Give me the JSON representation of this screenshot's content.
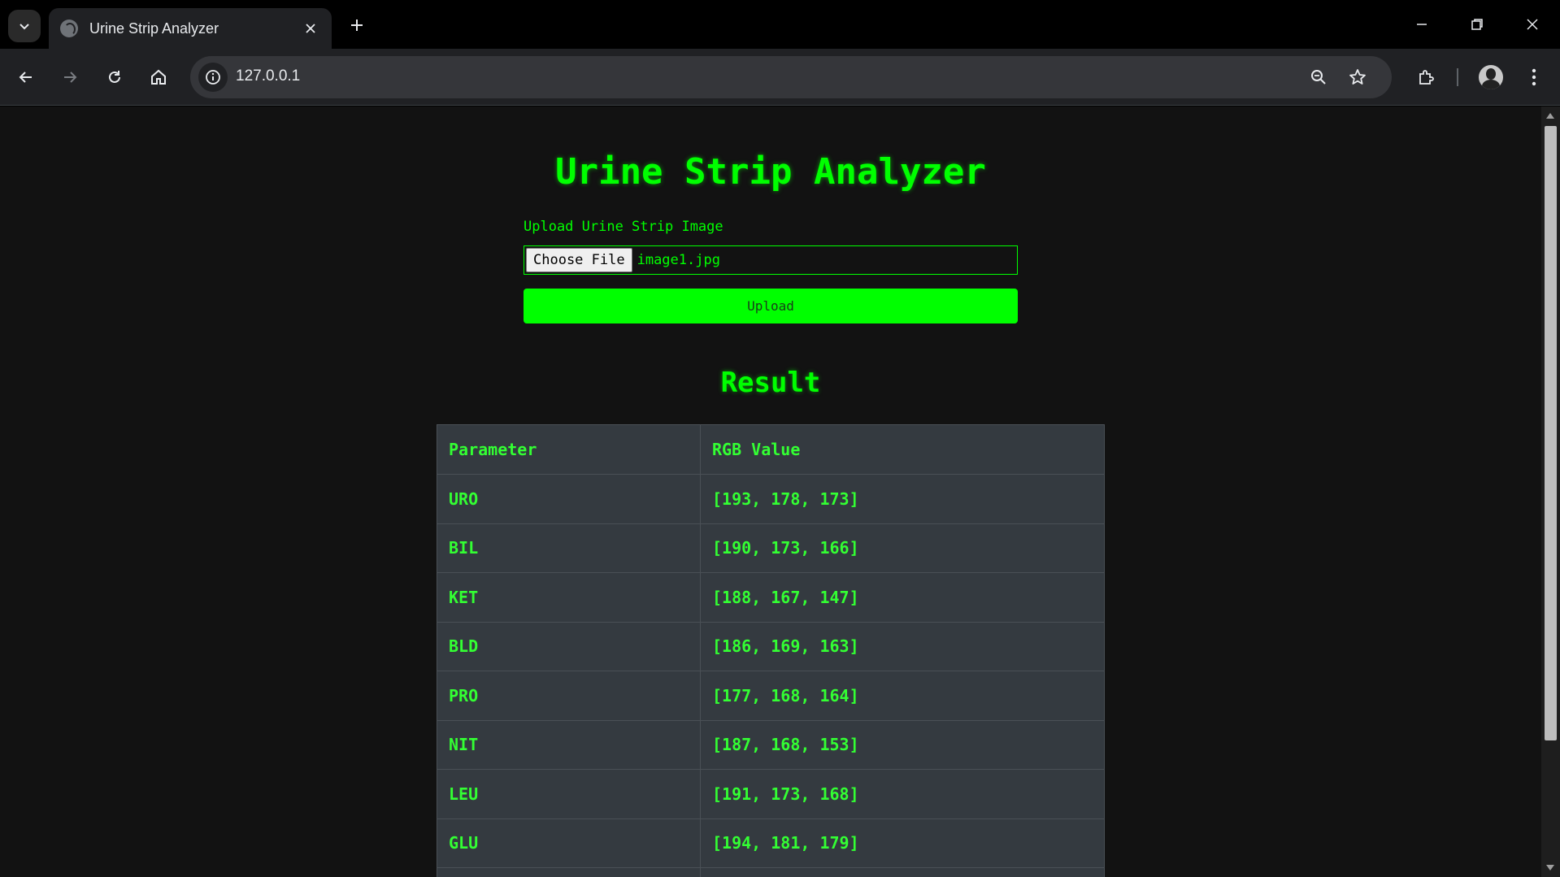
{
  "browser": {
    "tab_title": "Urine Strip Analyzer",
    "url": "127.0.0.1"
  },
  "page": {
    "title": "Urine Strip Analyzer",
    "upload_label": "Upload Urine Strip Image",
    "choose_file_label": "Choose File",
    "file_name": "image1.jpg",
    "upload_button": "Upload",
    "result_title": "Result",
    "table": {
      "headers": [
        "Parameter",
        "RGB Value"
      ],
      "rows": [
        {
          "parameter": "URO",
          "rgb": "[193, 178, 173]"
        },
        {
          "parameter": "BIL",
          "rgb": "[190, 173, 166]"
        },
        {
          "parameter": "KET",
          "rgb": "[188, 167, 147]"
        },
        {
          "parameter": "BLD",
          "rgb": "[186, 169, 163]"
        },
        {
          "parameter": "PRO",
          "rgb": "[177, 168, 164]"
        },
        {
          "parameter": "NIT",
          "rgb": "[187, 168, 153]"
        },
        {
          "parameter": "LEU",
          "rgb": "[191, 173, 168]"
        },
        {
          "parameter": "GLU",
          "rgb": "[194, 181, 179]"
        }
      ]
    }
  },
  "colors": {
    "accent": "#00ff00",
    "page_background": "#121212",
    "table_background": "#343a40"
  },
  "icons": [
    "tab-search-icon",
    "globe-icon",
    "close-icon",
    "plus-icon",
    "minimize-icon",
    "restore-icon",
    "back-icon",
    "forward-icon",
    "reload-icon",
    "home-icon",
    "info-icon",
    "zoom-icon",
    "star-icon",
    "extensions-icon",
    "avatar-icon",
    "menu-icon"
  ]
}
